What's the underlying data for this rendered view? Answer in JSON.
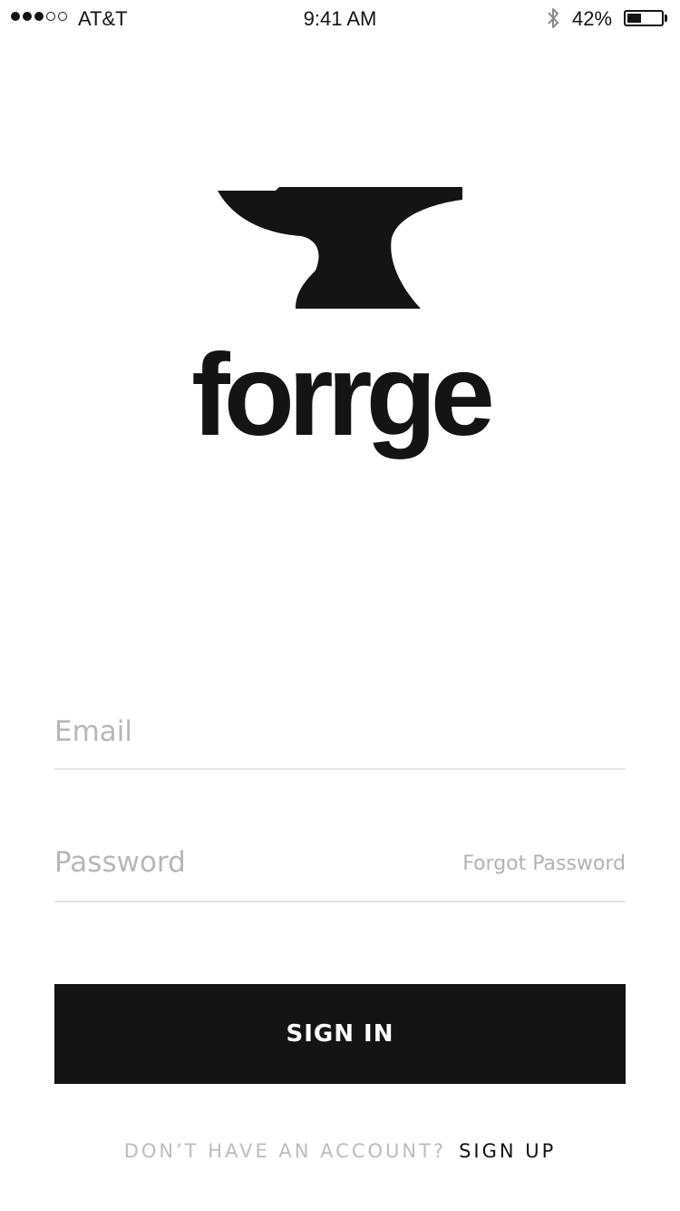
{
  "status_bar": {
    "carrier": "AT&T",
    "time": "9:41 AM",
    "battery_percent": "42%",
    "signal_bars": [
      true,
      true,
      true,
      false,
      false
    ],
    "battery_level": 0.42
  },
  "brand": {
    "wordmark": "forrge",
    "logo_icon": "anvil-icon"
  },
  "form": {
    "email_placeholder": "Email",
    "password_placeholder": "Password",
    "forgot_password_label": "Forgot Password",
    "sign_in_label": "SIGN IN"
  },
  "footer": {
    "prompt": "DON’T HAVE AN ACCOUNT?",
    "sign_up_label": "SIGN UP"
  },
  "colors": {
    "primary": "#141414",
    "placeholder": "#b7b7b7",
    "divider": "#e6e6e6",
    "background": "#ffffff"
  }
}
